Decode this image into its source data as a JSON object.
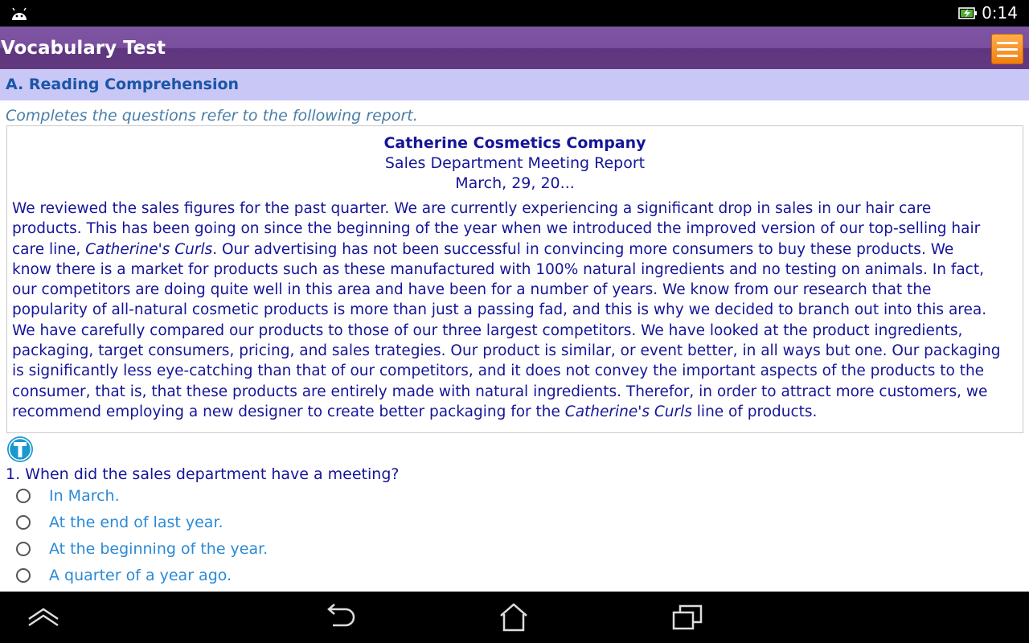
{
  "status_bar": {
    "time": "0:14",
    "icons": [
      "android-icon",
      "battery-charging-icon"
    ]
  },
  "action_bar": {
    "title": "Vocabulary Test",
    "menu_icon": "menu-icon"
  },
  "section": {
    "header": "A. Reading Comprehension",
    "instruction": "Completes the questions refer to the following report."
  },
  "report": {
    "company": "Catherine Cosmetics Company",
    "subtitle": "Sales Department Meeting Report",
    "date": "March, 29, 20...",
    "lines": [
      {
        "text": "We reviewed the sales figures for the past quarter. We are currently experiencing a significant drop in sales in our hair care"
      },
      {
        "text": "products. This has been going on since the beginning of the year when we introduced the improved version of our top-selling hair"
      },
      {
        "pre": "care line, ",
        "em": "Catherine's Curls",
        "post": ". Our advertising has not been successful in convincing more consumers to buy these products. We"
      },
      {
        "text": "know there is a market for products such as these manufactured with 100% natural ingredients and no testing on animals. In fact,"
      },
      {
        "text": "our competitors are doing quite well in this area and have been for a number of years. We know from our research that the"
      },
      {
        "text": "popularity of all-natural cosmetic products is more than just a passing fad, and this is why we decided to branch out into this area."
      },
      {
        "text": "We have carefully compared our products to those of our three largest competitors. We have looked at the product ingredients,"
      },
      {
        "text": "packaging, target consumers, pricing, and sales trategies. Our product is similar, or event better, in all ways but one. Our packaging"
      },
      {
        "text": "is significantly less eye-catching than that of our competitors, and it does not convey the important aspects of the products to the"
      },
      {
        "text": "consumer, that is, that these products are entirely made with natural ingredients. Therefor, in order to attract more customers, we"
      },
      {
        "pre": "recommend employing a new designer to create better packaging for the ",
        "em": "Catherine's Curls",
        "post": " line of products."
      }
    ]
  },
  "question": {
    "text": "1. When did the sales department have a meeting?",
    "options": [
      "In March.",
      "At the end of last year.",
      "At the beginning of the year.",
      "A quarter of a year ago."
    ]
  },
  "colors": {
    "action_bar": "#6b4390",
    "section_header_bg": "#c9c7f5",
    "report_text": "#15159a",
    "option_text": "#2a8ad6",
    "menu_button": "#f59a2e"
  },
  "nav_bar": {
    "icons": [
      "recent-up-icon",
      "back-icon",
      "home-icon",
      "recent-apps-icon"
    ]
  }
}
